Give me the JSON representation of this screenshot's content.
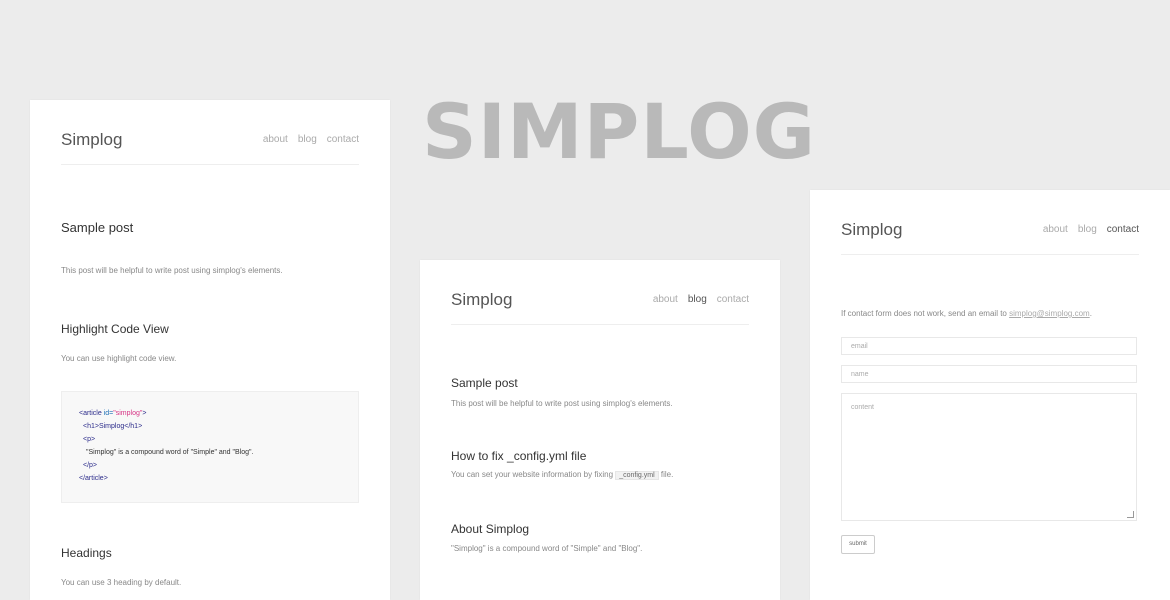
{
  "hero": {
    "title": "SIMPLOG"
  },
  "left_card": {
    "brand": "Simplog",
    "nav": {
      "about": "about",
      "blog": "blog",
      "contact": "contact"
    },
    "post_title": "Sample post",
    "post_desc": "This post will be helpful to write post using simplog's elements.",
    "highlight_title": "Highlight Code View",
    "highlight_desc": "You can use highlight code view.",
    "code": {
      "l1_open": "<article ",
      "l1_attr": "id=",
      "l1_val": "\"simplog\"",
      "l1_close": ">",
      "l2": "<h1>Simplog</h1>",
      "l3": "<p>",
      "l4": "\"Simplog\" is a compound word of \"Simple\" and \"Blog\".",
      "l5": "</p>",
      "l6": "</article>"
    },
    "headings_title": "Headings",
    "headings_desc": "You can use 3 heading by default."
  },
  "mid_card": {
    "brand": "Simplog",
    "nav": {
      "about": "about",
      "blog": "blog",
      "contact": "contact"
    },
    "posts": [
      {
        "title": "Sample post",
        "desc": "This post will be helpful to write post using simplog's elements."
      },
      {
        "title": "How to fix _config.yml file",
        "desc_pre": "You can set your website information by fixing",
        "desc_code": "_config.yml",
        "desc_post": "file."
      },
      {
        "title": "About Simplog",
        "desc": "\"Simplog\" is a compound word of \"Simple\" and \"Blog\"."
      }
    ]
  },
  "right_card": {
    "brand": "Simplog",
    "nav": {
      "about": "about",
      "blog": "blog",
      "contact": "contact"
    },
    "notice_pre": "If contact form does not work, send an email to",
    "notice_email": "simplog@simplog.com",
    "notice_post": ".",
    "email_placeholder": "email",
    "name_placeholder": "name",
    "content_placeholder": "content",
    "submit_label": "submit"
  }
}
